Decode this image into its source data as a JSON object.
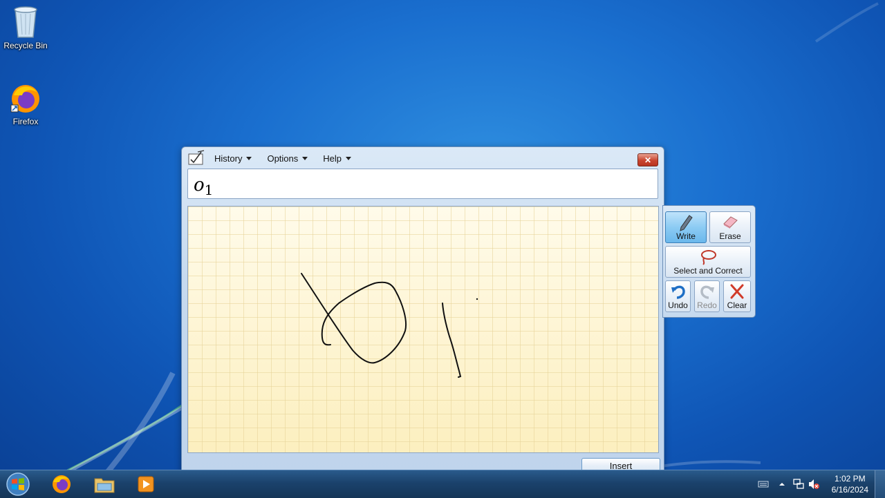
{
  "desktop": {
    "icons": [
      {
        "label": "Recycle Bin",
        "icon": "recycle-bin-icon"
      },
      {
        "label": "Firefox",
        "icon": "firefox-icon"
      }
    ]
  },
  "math_panel": {
    "menu": {
      "history": "History",
      "options": "Options",
      "help": "Help"
    },
    "preview": {
      "base": "o",
      "subscript": "1"
    },
    "insert_label": "Insert"
  },
  "tools": {
    "write": "Write",
    "erase": "Erase",
    "select_correct": "Select and Correct",
    "undo": "Undo",
    "redo": "Redo",
    "clear": "Clear",
    "active_tool": "Write"
  },
  "taskbar": {
    "apps": [
      "firefox-icon",
      "file-explorer-icon",
      "media-player-icon"
    ],
    "clock_time": "1:02 PM",
    "clock_date": "6/16/2024"
  },
  "colors": {
    "canvas": "#fdf3c6",
    "active_tool": "#8ccbf3",
    "close_button": "#c9452f"
  }
}
